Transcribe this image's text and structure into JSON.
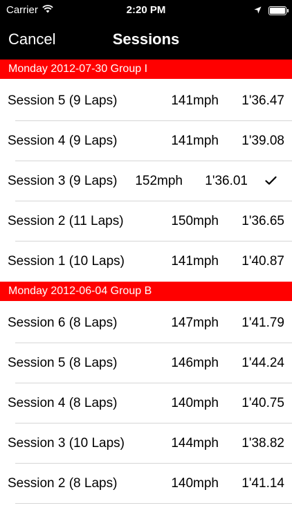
{
  "status": {
    "carrier": "Carrier",
    "time": "2:20 PM"
  },
  "nav": {
    "cancel_label": "Cancel",
    "title": "Sessions"
  },
  "groups": [
    {
      "header": "Monday 2012-07-30 Group I",
      "rows": [
        {
          "name": "Session 5 (9 Laps)",
          "speed": "141mph",
          "time": "1'36.47"
        },
        {
          "name": "Session 4 (9 Laps)",
          "speed": "141mph",
          "time": "1'39.08"
        },
        {
          "name": "Session 3 (9 Laps)",
          "speed": "152mph",
          "time": "1'36.01",
          "checked": true
        },
        {
          "name": "Session 2 (11 Laps)",
          "speed": "150mph",
          "time": "1'36.65"
        },
        {
          "name": "Session 1 (10 Laps)",
          "speed": "141mph",
          "time": "1'40.87"
        }
      ]
    },
    {
      "header": "Monday 2012-06-04 Group B",
      "rows": [
        {
          "name": "Session 6 (8 Laps)",
          "speed": "147mph",
          "time": "1'41.79"
        },
        {
          "name": "Session 5 (8 Laps)",
          "speed": "146mph",
          "time": "1'44.24"
        },
        {
          "name": "Session 4 (8 Laps)",
          "speed": "140mph",
          "time": "1'40.75"
        },
        {
          "name": "Session 3 (10 Laps)",
          "speed": "144mph",
          "time": "1'38.82"
        },
        {
          "name": "Session 2 (8 Laps)",
          "speed": "140mph",
          "time": "1'41.14"
        }
      ]
    }
  ],
  "colors": {
    "section_header_bg": "#ff0000",
    "bar_bg": "#000000"
  },
  "icons": {
    "wifi": "wifi-icon",
    "location": "location-arrow-icon",
    "battery": "battery-icon",
    "check": "checkmark-icon"
  }
}
